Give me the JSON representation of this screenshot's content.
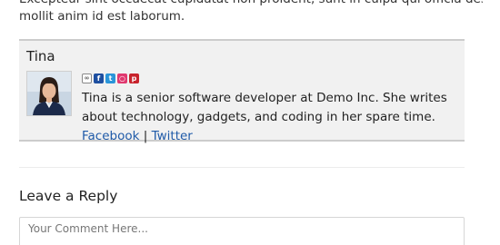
{
  "post": {
    "partial_line": "Excepteur sint occaecat cupidatat non proident, sunt in culpa qui officia deserunt",
    "last_line": "mollit anim id est laborum."
  },
  "author": {
    "name": "Tina",
    "bio": "Tina is a senior software developer at Demo Inc. She writes about technology, gadgets, and coding in her spare time.",
    "facebook_label": "Facebook",
    "separator": "|",
    "twitter_label": "Twitter",
    "social_icons": [
      "link-icon",
      "facebook-icon",
      "twitter-icon",
      "instagram-icon",
      "pinterest-icon"
    ]
  },
  "reply": {
    "title": "Leave a Reply",
    "comment_placeholder": "Your Comment Here..."
  },
  "colors": {
    "link": "#1f5aa8",
    "author_box_bg": "#f1f1f1",
    "facebook": "#1e4fa0",
    "twitter": "#2a95d9",
    "instagram": "#e0386f",
    "pinterest": "#c8232c"
  }
}
